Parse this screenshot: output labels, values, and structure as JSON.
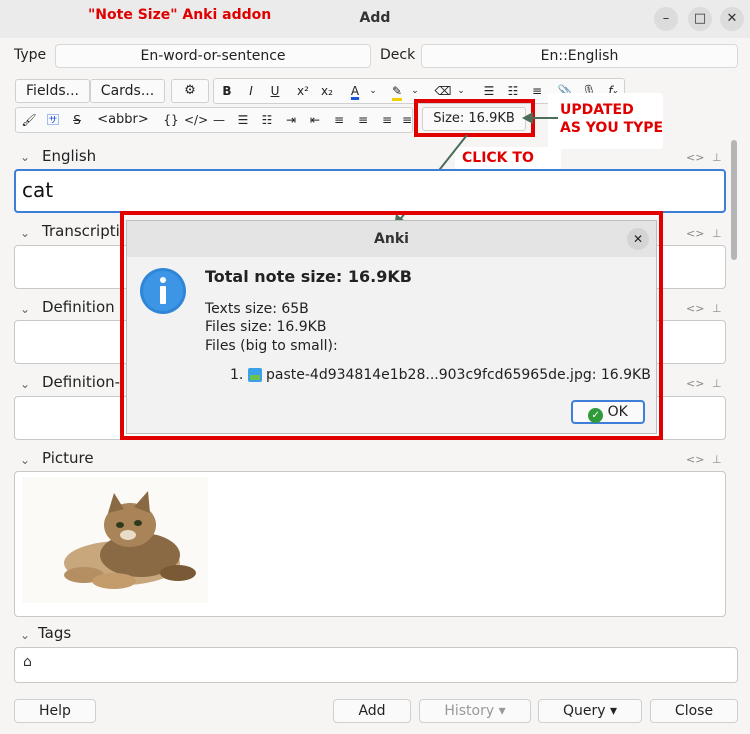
{
  "window": {
    "title": "Add"
  },
  "annotations": {
    "title_note": "\"Note Size\" Anki addon",
    "updated_note": "UPDATED\nAS YOU TYPE",
    "click_note": "CLICK TO\nSEE DETAILS",
    "accent_color": "#e00000"
  },
  "header": {
    "type_label": "Type",
    "type_value": "En-word-or-sentence",
    "deck_label": "Deck",
    "deck_value": "En::English"
  },
  "toolbar": {
    "fields_btn": "Fields...",
    "cards_btn": "Cards...",
    "abbr_btn": "<abbr>",
    "braces_btn": "{}",
    "size_btn": "Size: 16.9KB"
  },
  "fields": [
    {
      "name": "English",
      "value": "cat"
    },
    {
      "name": "Transcripti",
      "value": ""
    },
    {
      "name": "Definition",
      "value": ""
    },
    {
      "name": "Definition-",
      "value": ""
    },
    {
      "name": "Picture",
      "value": ""
    }
  ],
  "tags": {
    "label": "Tags"
  },
  "dialog": {
    "title": "Anki",
    "heading": "Total note size: 16.9KB",
    "texts_size": "Texts size: 65B",
    "files_size": "Files size: 16.9KB",
    "files_label": "Files (big to small):",
    "file_index": "1.",
    "file_name": "paste-4d934814e1b28...903c9fcd65965de.jpg: 16.9KB",
    "ok_label": "OK"
  },
  "bottom": {
    "help": "Help",
    "add": "Add",
    "history": "History ▾",
    "query": "Query ▾",
    "close": "Close"
  }
}
